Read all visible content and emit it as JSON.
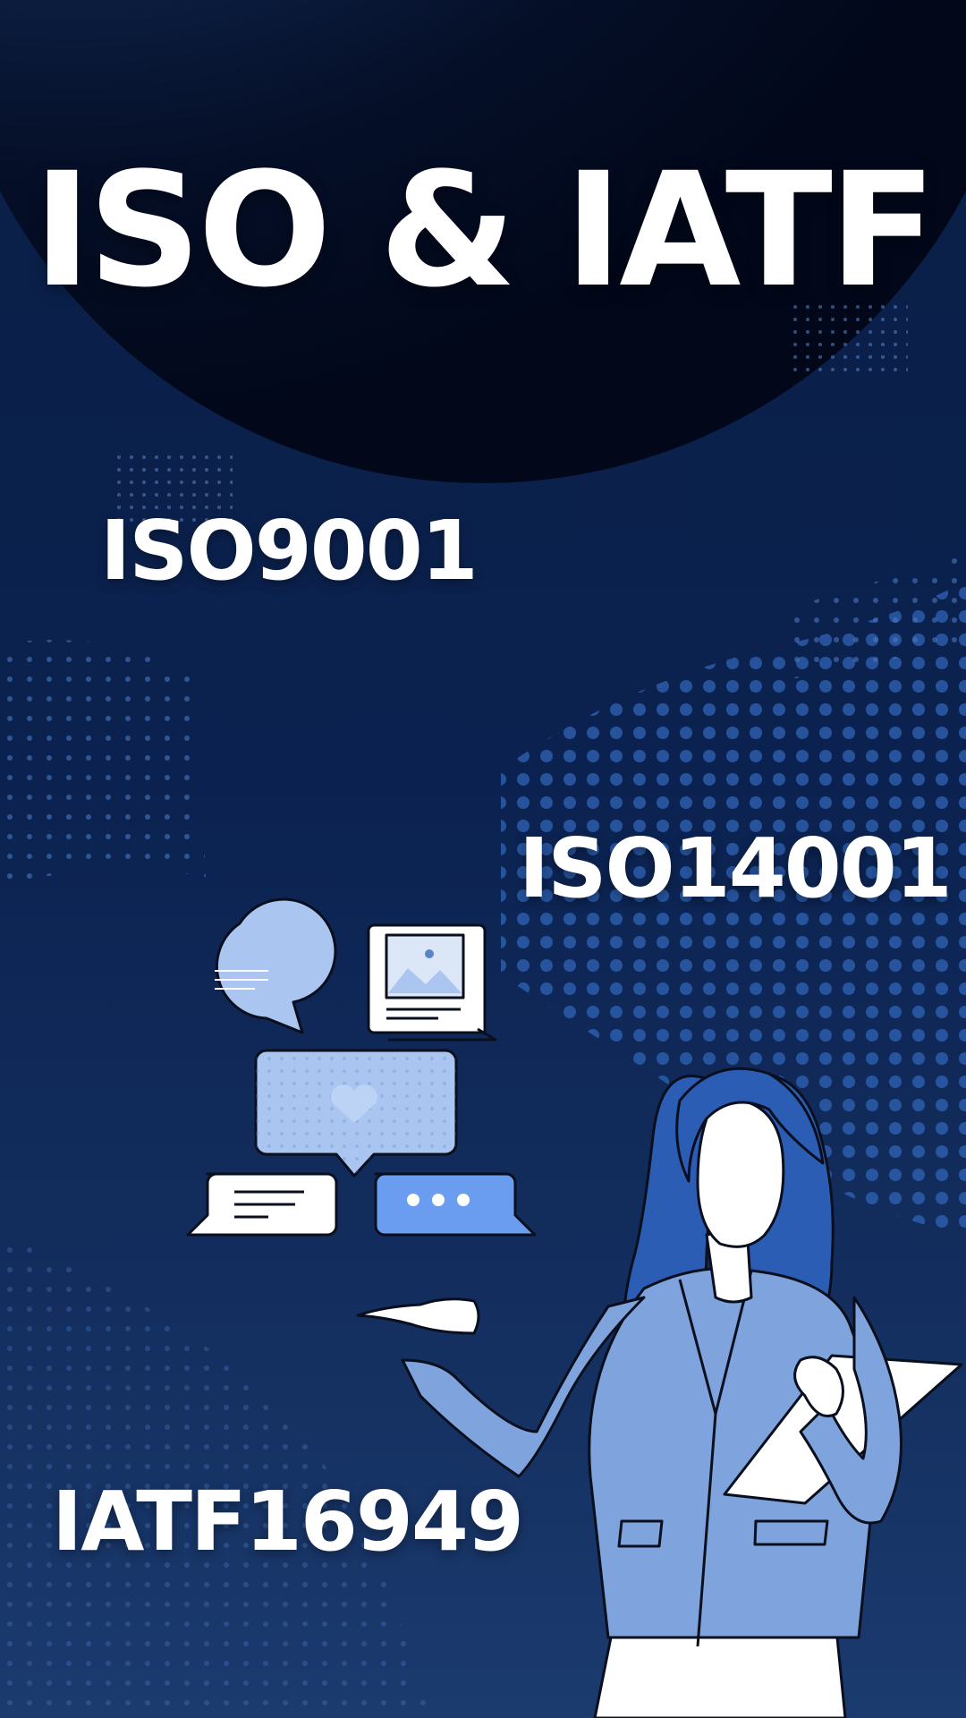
{
  "poster": {
    "title": "ISO & IATF",
    "standards": [
      "ISO9001",
      "ISO14001",
      "IATF16949"
    ]
  },
  "colors": {
    "background_top": "#0a1f45",
    "background_bottom": "#1b3a6e",
    "sphere": "#030b1f",
    "dots": "#2f63b5",
    "blazer": "#7fa3dc",
    "hair": "#2a5db3",
    "bubble": "#a9c5f0",
    "chat_button": "#6a9cf0"
  },
  "icons": [
    "speech-bubble-icon",
    "monitor-image-icon",
    "heart-message-icon",
    "text-message-icon",
    "typing-message-icon",
    "presenter-woman-illustration",
    "clipboard-icon"
  ]
}
